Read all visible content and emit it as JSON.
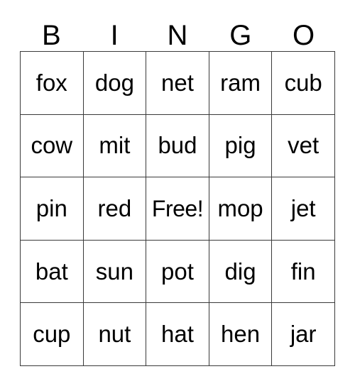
{
  "card": {
    "title": "BINGO",
    "columns": [
      "B",
      "I",
      "N",
      "G",
      "O"
    ],
    "free_space_label": "Free!",
    "free_space_position": {
      "row": 2,
      "col": 2
    },
    "colors": {
      "background": "#ffffff",
      "text": "#000000",
      "grid_line": "#3a3a3a"
    },
    "rows": [
      {
        "cells": [
          "fox",
          "dog",
          "net",
          "ram",
          "cub"
        ]
      },
      {
        "cells": [
          "cow",
          "mit",
          "bud",
          "pig",
          "vet"
        ]
      },
      {
        "cells": [
          "pin",
          "red",
          "Free!",
          "mop",
          "jet"
        ]
      },
      {
        "cells": [
          "bat",
          "sun",
          "pot",
          "dig",
          "fin"
        ]
      },
      {
        "cells": [
          "cup",
          "nut",
          "hat",
          "hen",
          "jar"
        ]
      }
    ]
  }
}
